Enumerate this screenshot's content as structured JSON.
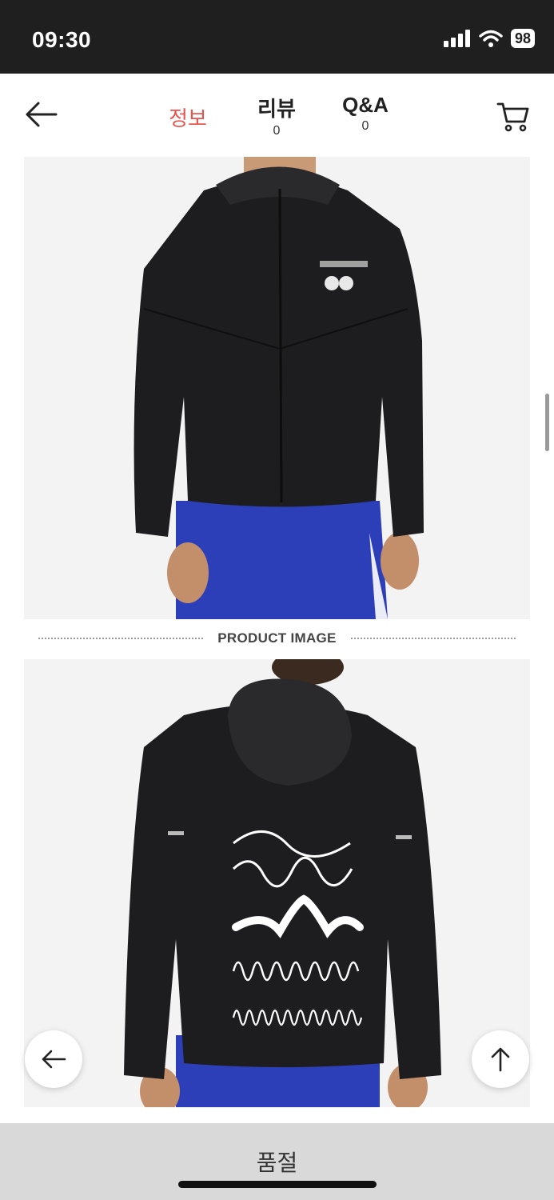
{
  "status_bar": {
    "time": "09:30",
    "battery": "98"
  },
  "nav": {
    "tabs": [
      {
        "label": "정보",
        "count": ""
      },
      {
        "label": "리뷰",
        "count": "0"
      },
      {
        "label": "Q&A",
        "count": "0"
      }
    ]
  },
  "content": {
    "divider_label": "PRODUCT IMAGE"
  },
  "footer": {
    "button_label": "품절"
  },
  "colors": {
    "accent": "#e9544f",
    "footer_bg": "#d9d9d9"
  }
}
